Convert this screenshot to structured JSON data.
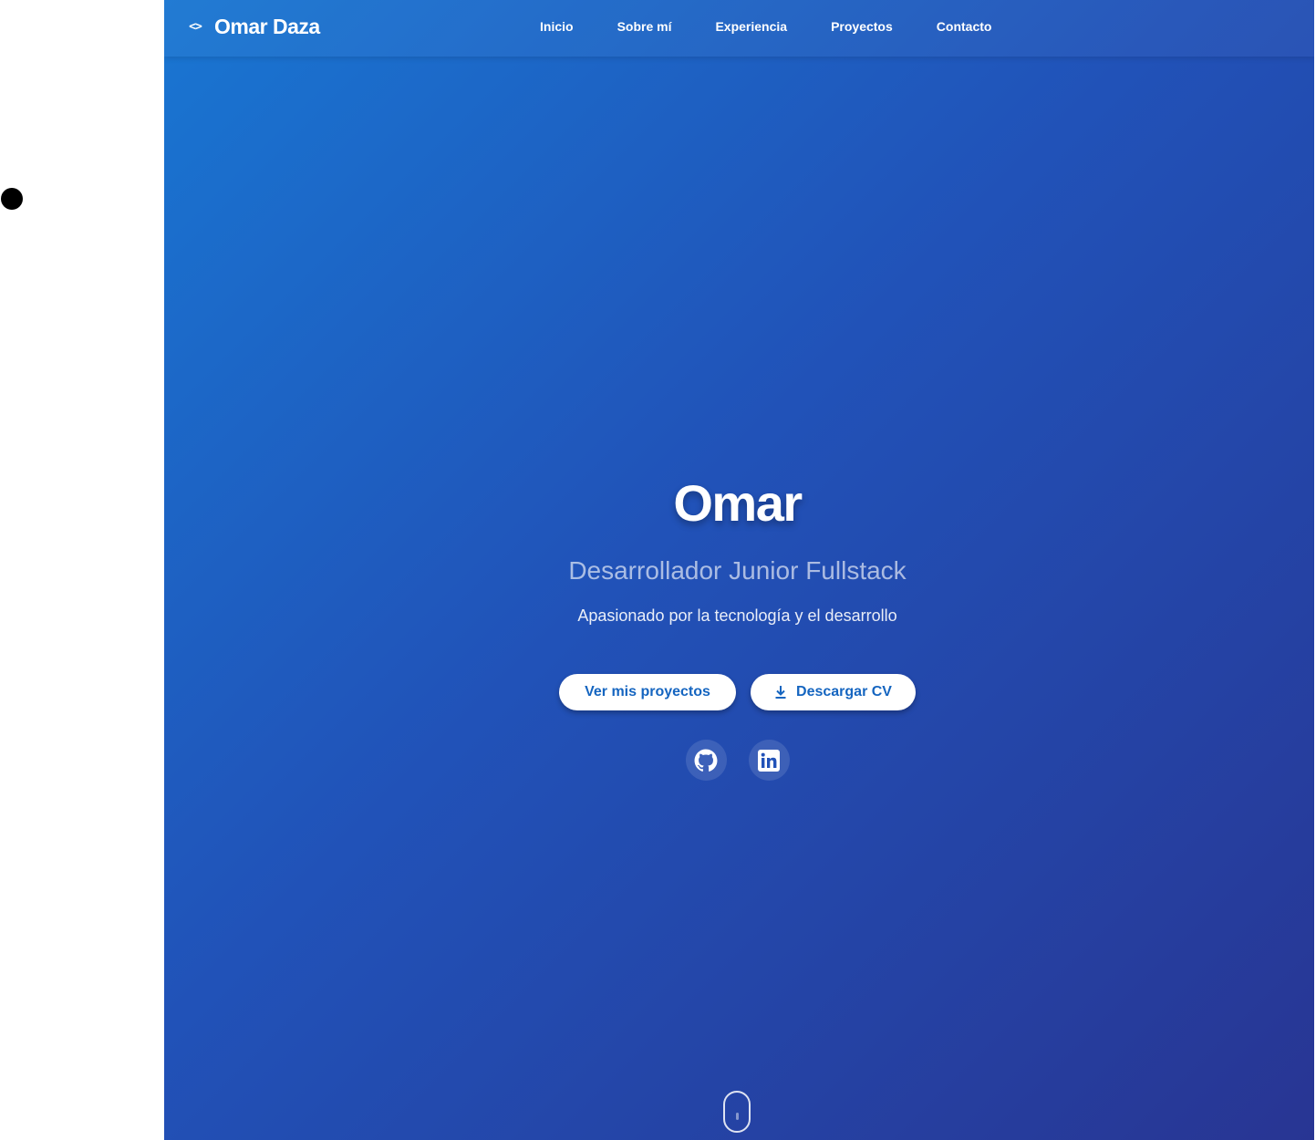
{
  "navbar": {
    "brand_icon": "<>",
    "brand_name": "Omar Daza",
    "links": [
      "Inicio",
      "Sobre mí",
      "Experiencia",
      "Proyectos",
      "Contacto"
    ]
  },
  "hero": {
    "name": "Omar",
    "role": "Desarrollador Junior Fullstack",
    "tagline": "Apasionado por la tecnología y el desarrollo",
    "buttons": {
      "projects_label": "Ver mis proyectos",
      "cv_label": "Descargar CV",
      "cv_icon": "download-icon"
    },
    "socials": [
      {
        "icon": "github-icon"
      },
      {
        "icon": "linkedin-icon"
      }
    ]
  },
  "colors": {
    "gradient_start": "#1976d2",
    "gradient_end": "#283593",
    "button_text": "#1565c0",
    "text": "#ffffff"
  },
  "scroll_indicator": {
    "icon": "mouse-scroll-icon"
  }
}
